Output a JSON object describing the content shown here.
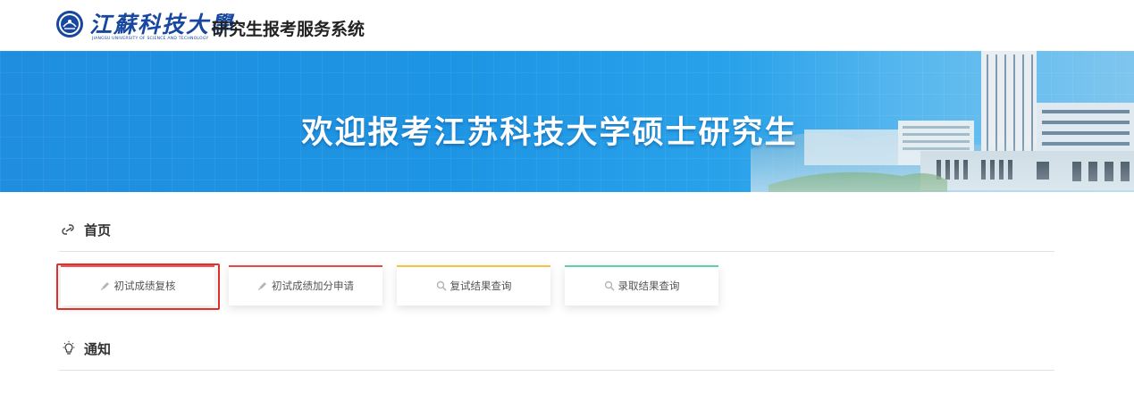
{
  "header": {
    "logo_script": "江蘇科技大學",
    "logo_english": "JIANGSU UNIVERSITY OF SCIENCE AND TECHNOLOGY",
    "system_title": "研究生报考服务系统"
  },
  "banner": {
    "title": "欢迎报考江苏科技大学硕士研究生"
  },
  "home_section": {
    "title": "首页",
    "icon": "link-icon"
  },
  "quick_links": [
    {
      "label": "初试成绩复核",
      "icon": "pencil-icon",
      "accent": "#e85a5a",
      "selected": true
    },
    {
      "label": "初试成绩加分申请",
      "icon": "pencil-icon",
      "accent": "#e04b4b",
      "selected": false
    },
    {
      "label": "复试结果查询",
      "icon": "search-icon",
      "accent": "#f5c242",
      "selected": false
    },
    {
      "label": "录取结果查询",
      "icon": "search-icon",
      "accent": "#5fcfa6",
      "selected": false
    }
  ],
  "notice_section": {
    "title": "通知",
    "icon": "lightbulb-icon"
  },
  "colors": {
    "brand_blue": "#17479e",
    "banner_blue": "#1e95e4",
    "highlight_red": "#e0302c"
  }
}
